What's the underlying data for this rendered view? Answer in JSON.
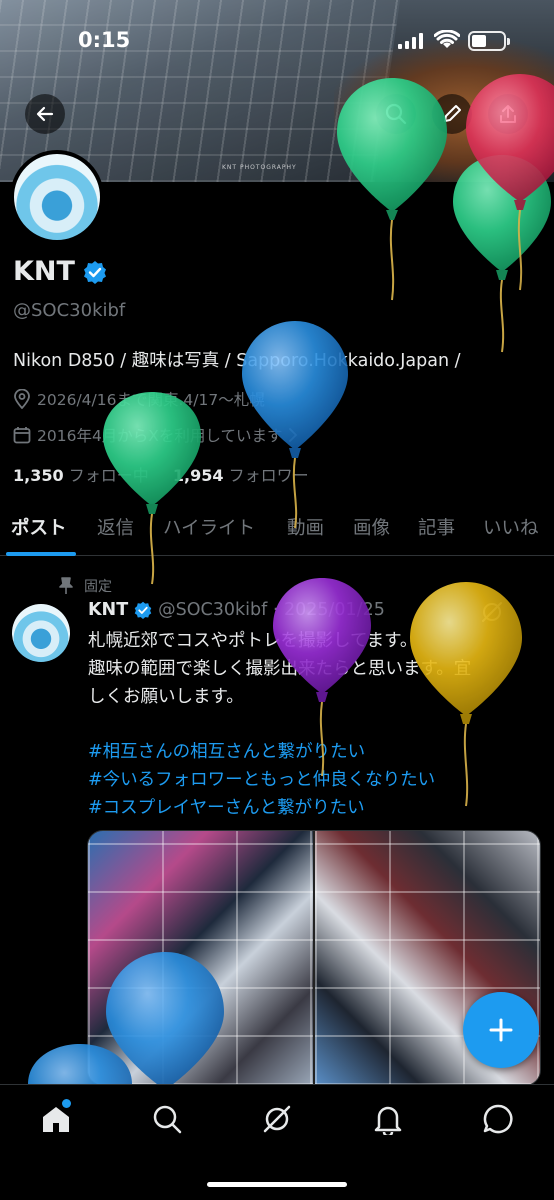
{
  "status_bar": {
    "time": "0:15"
  },
  "header": {
    "banner_watermark": "KNT PHOTOGRAPHY"
  },
  "profile": {
    "name": "KNT",
    "handle": "@SOC30kibf",
    "bio": "Nikon D850 / 趣味は写真 / Sapporo.Hokkaido.Japan /",
    "location": "2026/4/16まで関東.4/17～札幌",
    "joined": "2016年4月からXを利用しています",
    "following_count": "1,350",
    "following_label": "フォロー中",
    "followers_count": "1,954",
    "followers_label": "フォロワー"
  },
  "tabs": [
    "ポスト",
    "返信",
    "ハイライト",
    "動画",
    "画像",
    "記事",
    "いいね"
  ],
  "post": {
    "pinned_label": "固定",
    "author_name": "KNT",
    "author_handle_date": "@SOC30kibf · 2025/01/25",
    "text_lines": [
      "札幌近郊でコスやポトレを撮影してます。",
      "趣味の範囲で楽しく撮影出来たらと思います。宜",
      "しくお願いします。"
    ],
    "hashtags": [
      "#相互さんの相互さんと繋がりたい",
      "#今いるフォロワーともっと仲良くなりたい",
      "#コスプレイヤーさんと繋がりたい"
    ]
  },
  "colors": {
    "accent": "#1d9bf0",
    "background": "#000000",
    "secondary_text": "#71767b",
    "balloon_green": "#2ecf8a",
    "balloon_red": "#e0325a",
    "balloon_blue": "#2a8fe0",
    "balloon_purple": "#9a2fd8",
    "balloon_yellow": "#e8b913"
  },
  "icons": {
    "back": "back-arrow-icon",
    "search": "search-icon",
    "compose": "pencil-icon",
    "share": "share-icon",
    "verified": "verified-badge-icon",
    "location": "location-pin-icon",
    "calendar": "calendar-icon",
    "pin": "pin-icon",
    "fab": "plus-icon",
    "nav": [
      "home-icon",
      "search-icon",
      "grok-icon",
      "bell-icon",
      "messages-icon"
    ]
  }
}
